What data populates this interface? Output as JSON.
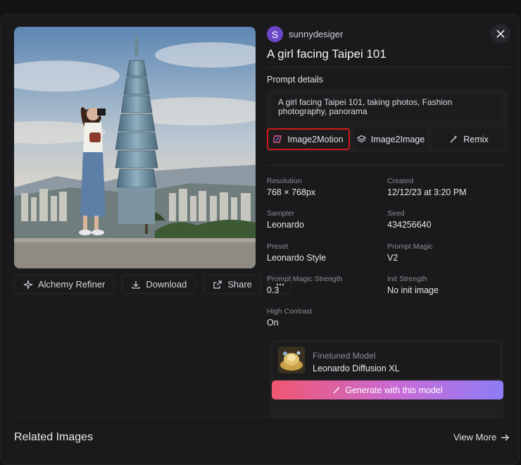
{
  "user": {
    "initial": "S",
    "name": "sunnydesiger"
  },
  "title": "A girl facing Taipei 101",
  "prompt": {
    "label": "Prompt details",
    "text": "A girl facing Taipei 101, taking photos, Fashion photography, panorama",
    "buttons": {
      "image2motion": "Image2Motion",
      "image2image": "Image2Image",
      "remix": "Remix"
    }
  },
  "meta": {
    "resolution": {
      "label": "Resolution",
      "value": "768 × 768px"
    },
    "created": {
      "label": "Created",
      "value": "12/12/23 at 3:20 PM"
    },
    "sampler": {
      "label": "Sampler",
      "value": "Leonardo"
    },
    "seed": {
      "label": "Seed",
      "value": "434256640"
    },
    "preset": {
      "label": "Preset",
      "value": "Leonardo Style"
    },
    "prompt_magic": {
      "label": "Prompt Magic",
      "value": "V2"
    },
    "prompt_magic_strength": {
      "label": "Prompt Magic Strength",
      "value": "0.3"
    },
    "init_strength": {
      "label": "Init Strength",
      "value": "No init image"
    },
    "high_contrast": {
      "label": "High Contrast",
      "value": "On"
    }
  },
  "model": {
    "label": "Finetuned Model",
    "name": "Leonardo Diffusion XL",
    "generate": "Generate with this model"
  },
  "actions": {
    "alchemy": "Alchemy Refiner",
    "download": "Download",
    "share": "Share"
  },
  "related": {
    "title": "Related Images",
    "view_more": "View More"
  },
  "colors": {
    "highlight": "#d11a1a",
    "avatar": "#6b47c7",
    "gradient_start": "#f0576f",
    "gradient_end": "#8d7cf4"
  }
}
